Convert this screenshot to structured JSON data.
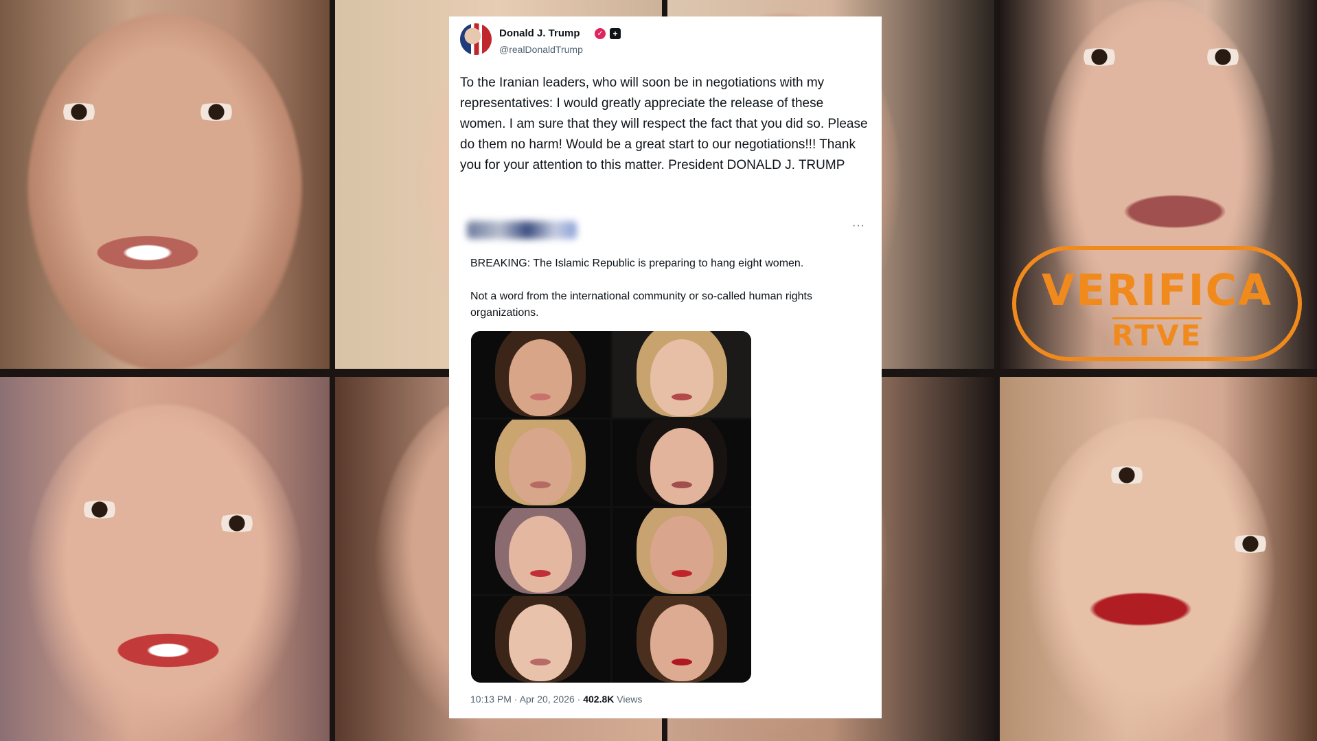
{
  "tweet": {
    "author_name": "Donald J. Trump",
    "handle": "@realDonaldTrump",
    "text": "To the Iranian leaders, who will soon be in negotiations with my representatives: I would greatly appreciate the release of these women. I am sure that they will respect the fact that you did so. Please do them no harm! Would be a great start to our negotiations!!! Thank you for your attention to this matter. President DONALD J. TRUMP",
    "verified_icon": "verified-badge-icon",
    "affiliate_icon": "affiliate-badge-icon"
  },
  "quote": {
    "more_label": "···",
    "paragraph_1": "BREAKING: The Islamic Republic is preparing to hang eight women.",
    "paragraph_2": "Not a word from the international community or so-called human rights organizations."
  },
  "meta": {
    "time_date": "10:13 PM · Apr 20, 2026 · ",
    "views_count": "402.8K",
    "views_label": " Views"
  },
  "watermark": {
    "line1": "VERIFICA",
    "line2": "RTVE",
    "color": "#f18a1c"
  }
}
